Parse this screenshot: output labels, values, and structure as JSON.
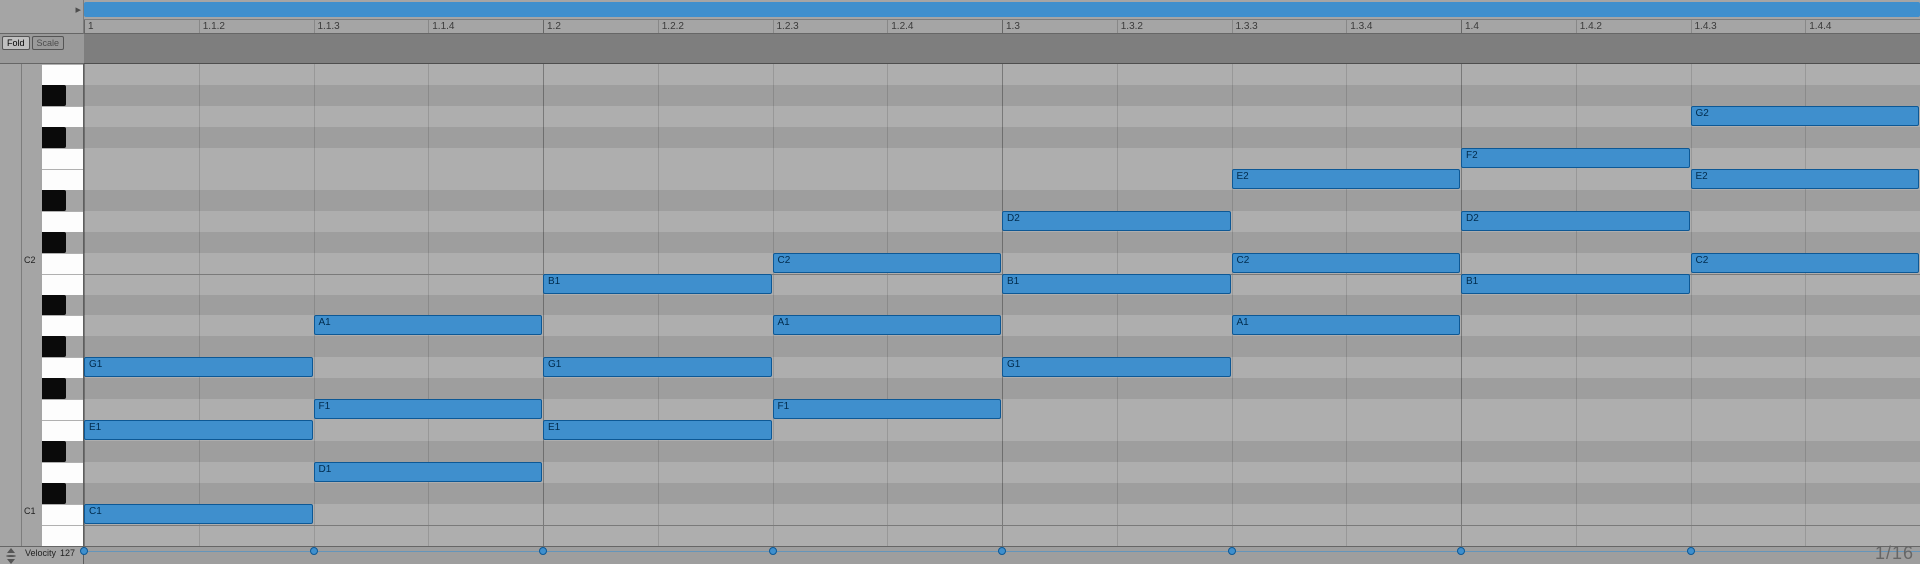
{
  "colors": {
    "note_fill": "#3f8fcd",
    "note_border": "#0d5895"
  },
  "header": {
    "fold_label": "Fold",
    "scale_label": "Scale"
  },
  "ruler": {
    "ticks": [
      {
        "label": "1",
        "beat": 0,
        "major": true
      },
      {
        "label": "1.1.2",
        "beat": 1,
        "major": false
      },
      {
        "label": "1.1.3",
        "beat": 2,
        "major": false
      },
      {
        "label": "1.1.4",
        "beat": 3,
        "major": false
      },
      {
        "label": "1.2",
        "beat": 4,
        "major": true
      },
      {
        "label": "1.2.2",
        "beat": 5,
        "major": false
      },
      {
        "label": "1.2.3",
        "beat": 6,
        "major": false
      },
      {
        "label": "1.2.4",
        "beat": 7,
        "major": false
      },
      {
        "label": "1.3",
        "beat": 8,
        "major": true
      },
      {
        "label": "1.3.2",
        "beat": 9,
        "major": false
      },
      {
        "label": "1.3.3",
        "beat": 10,
        "major": false
      },
      {
        "label": "1.3.4",
        "beat": 11,
        "major": false
      },
      {
        "label": "1.4",
        "beat": 12,
        "major": true
      },
      {
        "label": "1.4.2",
        "beat": 13,
        "major": false
      },
      {
        "label": "1.4.3",
        "beat": 14,
        "major": false
      },
      {
        "label": "1.4.4",
        "beat": 15,
        "major": false
      }
    ]
  },
  "piano": {
    "top_midi": 45,
    "bottom_midi": 23,
    "c_labels": {
      "C1": 24,
      "C2": 36
    }
  },
  "steps": 16,
  "notes": [
    {
      "pitch": "C1",
      "midi": 24,
      "start_step": 0,
      "length_steps": 2
    },
    {
      "pitch": "E1",
      "midi": 28,
      "start_step": 0,
      "length_steps": 2
    },
    {
      "pitch": "G1",
      "midi": 31,
      "start_step": 0,
      "length_steps": 2
    },
    {
      "pitch": "D1",
      "midi": 26,
      "start_step": 2,
      "length_steps": 2
    },
    {
      "pitch": "F1",
      "midi": 29,
      "start_step": 2,
      "length_steps": 2
    },
    {
      "pitch": "A1",
      "midi": 33,
      "start_step": 2,
      "length_steps": 2
    },
    {
      "pitch": "E1",
      "midi": 28,
      "start_step": 4,
      "length_steps": 2
    },
    {
      "pitch": "G1",
      "midi": 31,
      "start_step": 4,
      "length_steps": 2
    },
    {
      "pitch": "B1",
      "midi": 35,
      "start_step": 4,
      "length_steps": 2
    },
    {
      "pitch": "F1",
      "midi": 29,
      "start_step": 6,
      "length_steps": 2
    },
    {
      "pitch": "A1",
      "midi": 33,
      "start_step": 6,
      "length_steps": 2
    },
    {
      "pitch": "C2",
      "midi": 36,
      "start_step": 6,
      "length_steps": 2
    },
    {
      "pitch": "G1",
      "midi": 31,
      "start_step": 8,
      "length_steps": 2
    },
    {
      "pitch": "B1",
      "midi": 35,
      "start_step": 8,
      "length_steps": 2
    },
    {
      "pitch": "D2",
      "midi": 38,
      "start_step": 8,
      "length_steps": 2
    },
    {
      "pitch": "A1",
      "midi": 33,
      "start_step": 10,
      "length_steps": 2
    },
    {
      "pitch": "C2",
      "midi": 36,
      "start_step": 10,
      "length_steps": 2
    },
    {
      "pitch": "E2",
      "midi": 40,
      "start_step": 10,
      "length_steps": 2
    },
    {
      "pitch": "B1",
      "midi": 35,
      "start_step": 12,
      "length_steps": 2
    },
    {
      "pitch": "D2",
      "midi": 38,
      "start_step": 12,
      "length_steps": 2
    },
    {
      "pitch": "F2",
      "midi": 41,
      "start_step": 12,
      "length_steps": 2
    },
    {
      "pitch": "C2",
      "midi": 36,
      "start_step": 14,
      "length_steps": 2
    },
    {
      "pitch": "E2",
      "midi": 40,
      "start_step": 14,
      "length_steps": 2
    },
    {
      "pitch": "G2",
      "midi": 43,
      "start_step": 14,
      "length_steps": 2
    }
  ],
  "velocity_lane": {
    "label": "Velocity",
    "max_label": "127",
    "snap_label": "1/16",
    "points_at_steps": [
      0,
      2,
      4,
      6,
      8,
      10,
      12,
      14
    ]
  }
}
